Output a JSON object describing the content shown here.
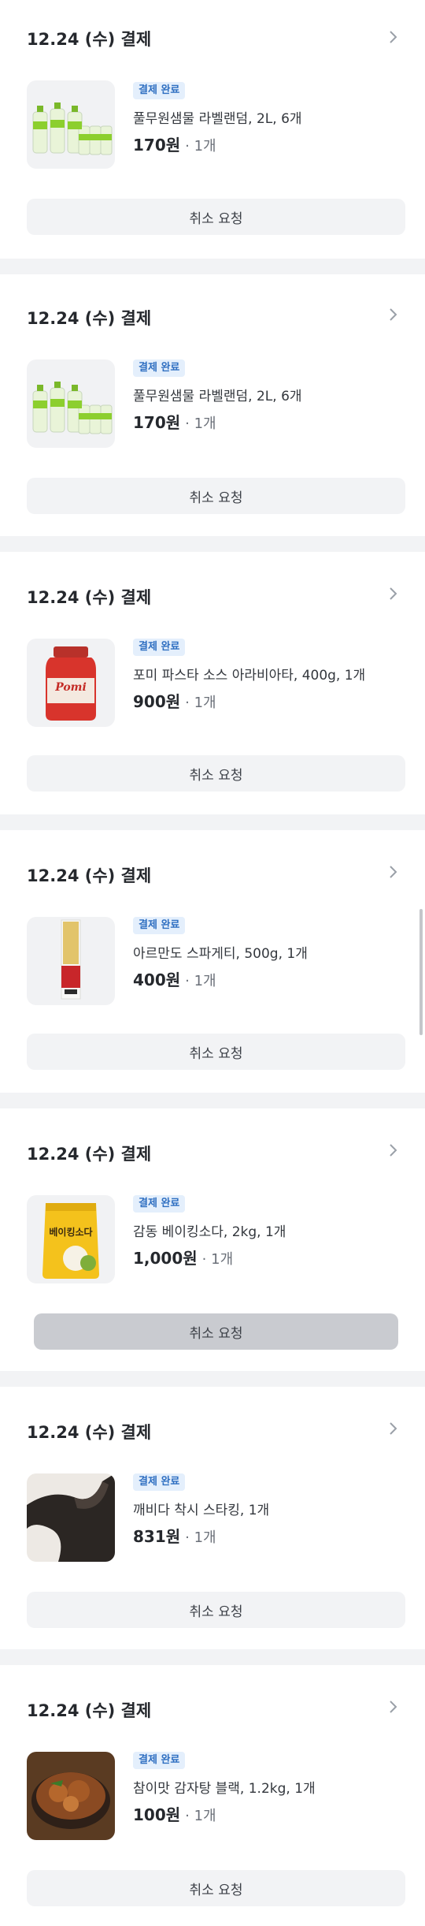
{
  "orders": [
    {
      "date": "12.24 (수) 결제",
      "status": "결제 완료",
      "name": "풀무원샘물 라벨랜덤, 2L, 6개",
      "price": "170원",
      "qty": "· 1개",
      "cancel": "취소 요청",
      "thumb": "water-bottles"
    },
    {
      "date": "12.24 (수) 결제",
      "status": "결제 완료",
      "name": "풀무원샘물 라벨랜덤, 2L, 6개",
      "price": "170원",
      "qty": "· 1개",
      "cancel": "취소 요청",
      "thumb": "water-bottles"
    },
    {
      "date": "12.24 (수) 결제",
      "status": "결제 완료",
      "name": "포미 파스타 소스 아라비아타, 400g, 1개",
      "price": "900원",
      "qty": "· 1개",
      "cancel": "취소 요청",
      "thumb": "pasta-sauce-jar",
      "thumb_label": "Pomi"
    },
    {
      "date": "12.24 (수) 결제",
      "status": "결제 완료",
      "name": "아르만도 스파게티, 500g, 1개",
      "price": "400원",
      "qty": "· 1개",
      "cancel": "취소 요청",
      "thumb": "spaghetti-box"
    },
    {
      "date": "12.24 (수) 결제",
      "status": "결제 완료",
      "name": "감동 베이킹소다, 2kg, 1개",
      "price": "1,000원",
      "qty": "· 1개",
      "cancel": "취소 요청",
      "thumb": "baking-soda-pouch",
      "thumb_label": "베이킹소다"
    },
    {
      "date": "12.24 (수) 결제",
      "status": "결제 완료",
      "name": "깨비다 착시 스타킹, 1개",
      "price": "831원",
      "qty": "· 1개",
      "cancel": "취소 요청",
      "thumb": "stocking-photo"
    },
    {
      "date": "12.24 (수) 결제",
      "status": "결제 완료",
      "name": "참이맛 감자탕 블랙, 1.2kg, 1개",
      "price": "100원",
      "qty": "· 1개",
      "cancel": "취소 요청",
      "thumb": "stew-bowl"
    }
  ],
  "icons": {
    "chevron": "chevron-right-icon"
  },
  "colors": {
    "badge_bg": "#e4effc",
    "badge_text": "#2f6fc1",
    "separator": "#f2f3f5",
    "button_bg": "#f2f3f5",
    "button_pressed": "#c9cbd0"
  }
}
